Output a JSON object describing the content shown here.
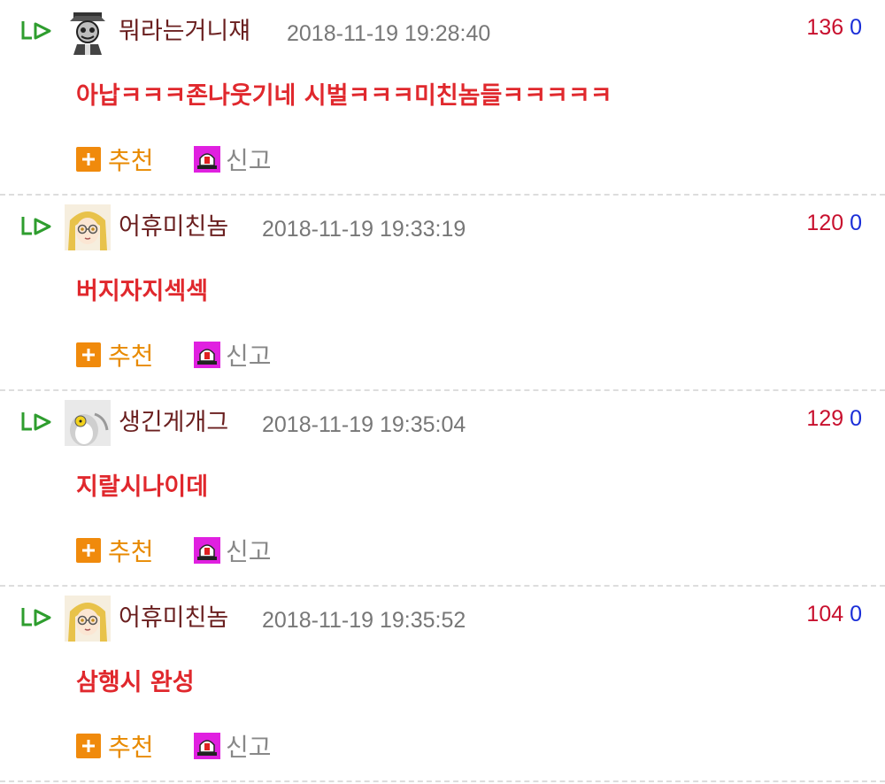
{
  "comments": [
    {
      "nickname": "뭐라는거니쟤",
      "datetime": "2018-11-19 19:28:40",
      "up": "136",
      "down": "0",
      "body": "아납ㅋㅋㅋ존나웃기네 시벌ㅋㅋㅋ미친놈들ㅋㅋㅋㅋㅋ",
      "recommend_label": "추천",
      "report_label": "신고",
      "avatar": "grayscale-cartoon-avatar"
    },
    {
      "nickname": "어휴미친놈",
      "datetime": "2018-11-19 19:33:19",
      "up": "120",
      "down": "0",
      "body": "버지자지섹섹",
      "recommend_label": "추천",
      "report_label": "신고",
      "avatar": "anime-girl-glasses-avatar"
    },
    {
      "nickname": "생긴게개그",
      "datetime": "2018-11-19 19:35:04",
      "up": "129",
      "down": "0",
      "body": "지랄시나이데",
      "recommend_label": "추천",
      "report_label": "신고",
      "avatar": "penguin-avatar"
    },
    {
      "nickname": "어휴미친놈",
      "datetime": "2018-11-19 19:35:52",
      "up": "104",
      "down": "0",
      "body": "삼행시 완성",
      "recommend_label": "추천",
      "report_label": "신고",
      "avatar": "anime-girl-glasses-avatar"
    }
  ],
  "colors": {
    "nickname": "#6a1f1f",
    "body": "#e0282d",
    "up_votes": "#c8102e",
    "down_votes": "#1a2ed8",
    "recommend": "#e88a00",
    "reply_icon": "#2e9d2e"
  }
}
